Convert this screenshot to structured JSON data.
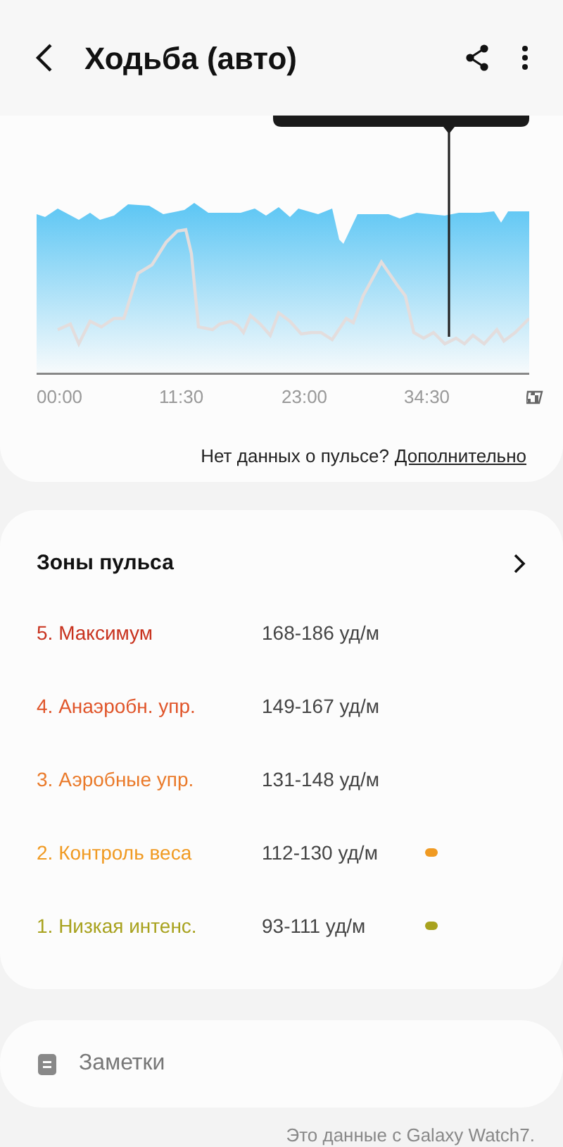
{
  "header": {
    "title": "Ходьба (авто)"
  },
  "chart": {
    "x_labels": [
      "00:00",
      "11:30",
      "23:00",
      "34:30"
    ],
    "note": "Нет данных о пульсе?",
    "link": "Дополнительно"
  },
  "zones": {
    "title": "Зоны пульса",
    "items": [
      {
        "label": "5. Максимум",
        "range": "168-186 уд/м",
        "color": "#c8321e",
        "indicator": false
      },
      {
        "label": "4. Анаэробн. упр.",
        "range": "149-167 уд/м",
        "color": "#e0552a",
        "indicator": false
      },
      {
        "label": "3. Аэробные упр.",
        "range": "131-148 уд/м",
        "color": "#ea7a2a",
        "indicator": false
      },
      {
        "label": "2. Контроль веса",
        "range": "112-130 уд/м",
        "color": "#f09a22",
        "indicator": true
      },
      {
        "label": "1. Низкая интенс.",
        "range": "93-111 уд/м",
        "color": "#a8a21e",
        "indicator": true
      }
    ]
  },
  "notes": {
    "label": "Заметки"
  },
  "footer": "Это данные с Galaxy Watch7."
}
